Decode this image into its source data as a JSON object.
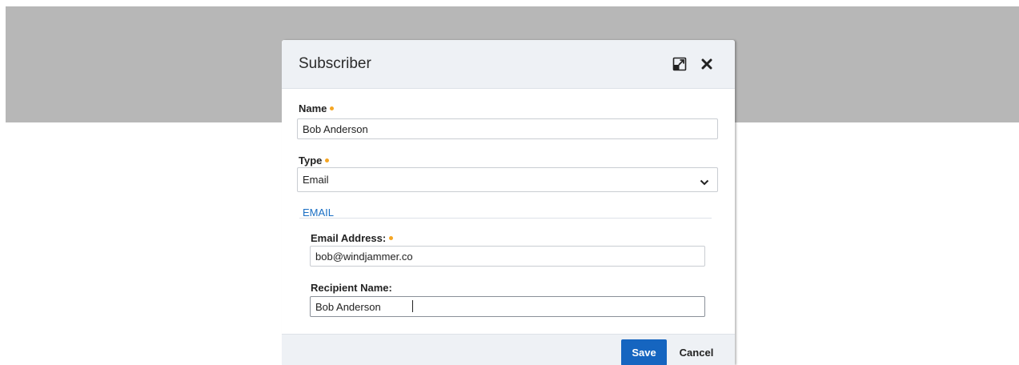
{
  "dialog": {
    "title": "Subscriber",
    "maximize_icon": "maximize-icon",
    "close_icon": "close-icon"
  },
  "form": {
    "name": {
      "label": "Name",
      "required": true,
      "value": "Bob Anderson"
    },
    "type": {
      "label": "Type",
      "required": true,
      "selected": "Email",
      "icon": "chevron-down-icon"
    },
    "email_section": {
      "title": "EMAIL",
      "email_address": {
        "label": "Email Address:",
        "required": true,
        "value": "bob@windjammer.co"
      },
      "recipient_name": {
        "label": "Recipient Name:",
        "required": false,
        "value": "Bob Anderson"
      }
    }
  },
  "footer": {
    "save_label": "Save",
    "cancel_label": "Cancel"
  },
  "colors": {
    "required_dot": "#f5a623",
    "section_title": "#1a6fc4",
    "primary_button": "#1565c0",
    "backdrop": "#b7b7b7",
    "header_bg": "#eef1f5"
  }
}
